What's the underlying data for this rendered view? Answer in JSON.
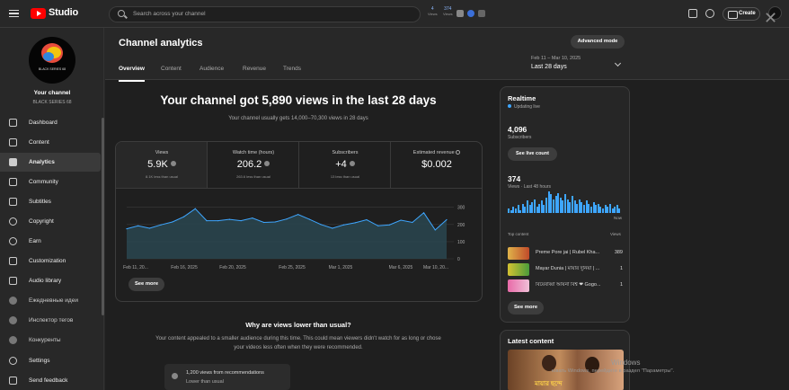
{
  "topbar": {
    "brand": "Studio",
    "search_placeholder": "Search across your channel",
    "stat1_value": "4",
    "stat1_label": "Views",
    "stat2_value": "374",
    "stat2_label": "Views",
    "create_label": "Create"
  },
  "sidebar": {
    "avatar_text": "BLACK SERIES 68",
    "your_channel": "Your channel",
    "channel_name": "BLACK SERIES 68",
    "items": [
      {
        "label": "Dashboard",
        "icon": "dashboard-icon"
      },
      {
        "label": "Content",
        "icon": "content-icon"
      },
      {
        "label": "Analytics",
        "icon": "analytics-icon"
      },
      {
        "label": "Community",
        "icon": "community-icon"
      },
      {
        "label": "Subtitles",
        "icon": "subtitles-icon"
      },
      {
        "label": "Copyright",
        "icon": "copyright-icon"
      },
      {
        "label": "Earn",
        "icon": "earn-icon"
      },
      {
        "label": "Customization",
        "icon": "customization-icon"
      },
      {
        "label": "Audio library",
        "icon": "audio-library-icon"
      },
      {
        "label": "Ежедневные идеи",
        "icon": "ideas-icon"
      },
      {
        "label": "Инспектор тегов",
        "icon": "tag-inspector-icon"
      },
      {
        "label": "Конкуренты",
        "icon": "competitors-icon"
      },
      {
        "label": "Settings",
        "icon": "settings-icon"
      },
      {
        "label": "Send feedback",
        "icon": "feedback-icon"
      }
    ]
  },
  "header": {
    "title": "Channel analytics",
    "tabs": [
      "Overview",
      "Content",
      "Audience",
      "Revenue",
      "Trends"
    ],
    "advanced_mode": "Advanced mode",
    "date_range": "Feb 11 – Mar 10, 2025",
    "date_label": "Last 28 days"
  },
  "overview": {
    "headline": "Your channel got 5,890 views in the last 28 days",
    "subline": "Your channel usually gets 14,000–70,300 views in 28 days",
    "kpis": [
      {
        "label": "Views",
        "value": "5.9K",
        "sub": "8.1K less than usual"
      },
      {
        "label": "Watch time (hours)",
        "value": "206.2",
        "sub": "263.6 less than usual"
      },
      {
        "label": "Subscribers",
        "value": "+4",
        "sub": "13 less than usual"
      },
      {
        "label": "Estimated revenue",
        "value": "$0.002",
        "sub": ""
      }
    ],
    "see_more": "See more",
    "why_title": "Why are views lower than usual?",
    "why_text": "Your content appealed to a smaller audience during this time. This could mean viewers didn't watch for as long or chose your videos less often when they were recommended.",
    "rec_title": "1,200 views from recommendations",
    "rec_sub": "Lower than usual"
  },
  "chart_data": {
    "type": "area",
    "x_ticks": [
      "Feb 11, 20...",
      "Feb 16, 2025",
      "Feb 20, 2025",
      "Feb 25, 2025",
      "Mar 1, 2025",
      "Mar 6, 2025",
      "Mar 10, 20..."
    ],
    "y_ticks": [
      "300",
      "200",
      "100",
      "0"
    ],
    "ylim": [
      0,
      330
    ],
    "series": [
      {
        "values": [
          175,
          192,
          178,
          198,
          215,
          245,
          292,
          222,
          222,
          230,
          222,
          238,
          212,
          215,
          232,
          258,
          230,
          200,
          178,
          198,
          210,
          228,
          192,
          198,
          225,
          212,
          268,
          168,
          228
        ]
      }
    ],
    "grid": true
  },
  "realtime": {
    "title": "Realtime",
    "status": "Updating live",
    "subs_value": "4,096",
    "subs_label": "Subscribers",
    "live_count": "See live count",
    "views_value": "374",
    "views_label": "Views · Last 48 hours",
    "now": "Now",
    "top_content": "Top content",
    "views_col": "Views",
    "bars": [
      3,
      2,
      4,
      3,
      5,
      2,
      6,
      4,
      8,
      5,
      7,
      9,
      4,
      6,
      8,
      5,
      10,
      14,
      12,
      9,
      11,
      13,
      10,
      8,
      12,
      9,
      7,
      11,
      8,
      6,
      9,
      7,
      5,
      8,
      6,
      4,
      7,
      5,
      6,
      4,
      3,
      5,
      4,
      6,
      3,
      4,
      5,
      3
    ],
    "items": [
      {
        "title": "Preme Pore jai | Rubel Kha...",
        "views": "389"
      },
      {
        "title": "Mayar Dunia | মায়ার দুনিয়া | ...",
        "views": "1"
      },
      {
        "title": "বিয়েবাব্বা আয়না বিশ্ব ❤ Gogo...",
        "views": "1"
      }
    ],
    "see_more": "See more"
  },
  "latest": {
    "title": "Latest content",
    "thumb_text": "মায়ার ছন্দে"
  },
  "watermark": {
    "line1": "Windows",
    "line2": "ювать Windows, перейдите в раздел \"Параметры\"."
  }
}
